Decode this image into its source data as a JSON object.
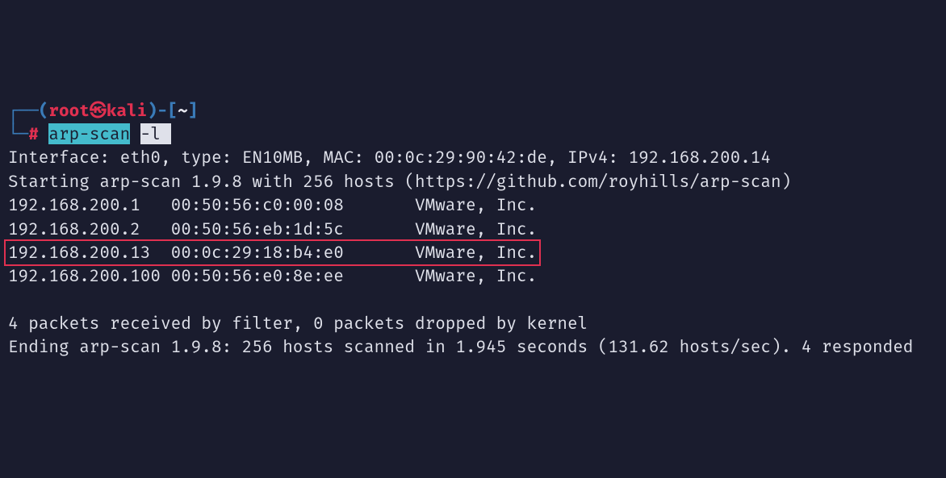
{
  "prompt": {
    "line_top_prefix": "┌──",
    "paren_open": "(",
    "user": "root",
    "symbol": "㉿",
    "host": "kali",
    "paren_close": ")",
    "dash": "-",
    "bracket_open": "[",
    "cwd": "~",
    "bracket_close": "]",
    "line_bottom_prefix": "└─",
    "hash": "#",
    "command": "arp-scan",
    "arg": "-l",
    "cursor": " "
  },
  "output": {
    "line1": "Interface: eth0, type: EN10MB, MAC: 00:0c:29:90:42:de, IPv4: 192.168.200.14",
    "line2": "Starting arp-scan 1.9.8 with 256 hosts (https://github.com/royhills/arp-scan)",
    "row1": "192.168.200.1   00:50:56:c0:00:08       VMware, Inc.",
    "row2": "192.168.200.2   00:50:56:eb:1d:5c       VMware, Inc.",
    "row3": "192.168.200.13  00:0c:29:18:b4:e0       VMware, Inc.",
    "row4": "192.168.200.100 00:50:56:e0:8e:ee       VMware, Inc.",
    "blank": "",
    "summary1": "4 packets received by filter, 0 packets dropped by kernel",
    "summary2": "Ending arp-scan 1.9.8: 256 hosts scanned in 1.945 seconds (131.62 hosts/sec). 4 responded"
  }
}
